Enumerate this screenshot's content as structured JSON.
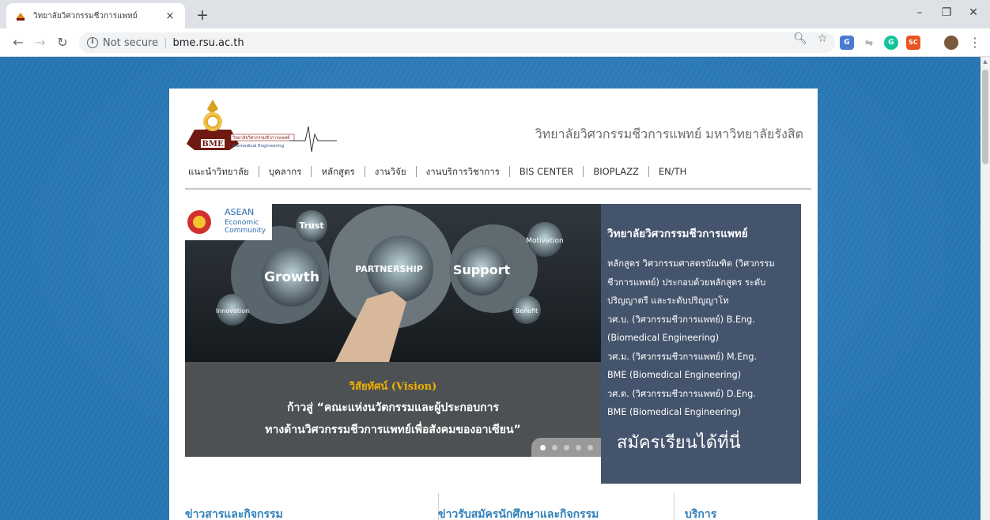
{
  "browser": {
    "tab_title": "วิทยาลัยวิศวกรรมชีวการแพทย์",
    "tab_close": "×",
    "new_tab": "+",
    "not_secure": "Not secure",
    "url": "bme.rsu.ac.th",
    "window_controls": {
      "minimize": "–",
      "restore": "❐",
      "close": "✕"
    },
    "extensions": [
      {
        "name": "translate",
        "label": "G",
        "color": "#4a7bd0"
      },
      {
        "name": "dropbox",
        "label": "⇋",
        "color": "#ffffff"
      },
      {
        "name": "grammarly",
        "label": "G",
        "color": "#15c39a"
      },
      {
        "name": "sc",
        "label": "SC",
        "color": "#e8551f"
      }
    ]
  },
  "site": {
    "logo_text": "BME",
    "logo_subtitle": "Biomedical Engineering",
    "logo_faculty": "วิทยาลัยวิศวกรรมชีวการแพทย์",
    "title": "วิทยาลัยวิศวกรรมชีวการแพทย์ มหาวิทยาลัยรังสิต",
    "nav": [
      "แนะนำวิทยาลัย",
      "บุคลากร",
      "หลักสูตร",
      "งานวิจัย",
      "งานบริการวิชาการ",
      "BIS CENTER",
      "BIOPLAZZ",
      "EN/TH"
    ]
  },
  "slider": {
    "badge": [
      "ASEAN",
      "Economic",
      "Community"
    ],
    "gears": [
      "Trust",
      "Growth",
      "PARTNERSHIP",
      "Support",
      "Motivation",
      "Innovation",
      "Benefit"
    ],
    "vision_label": "วิสัยทัศน์ (Vision)",
    "caption_line1": "ก้าวสู่ “คณะแห่งนวัตกรรมและผู้ประกอบการ",
    "caption_line2": "ทางด้านวิศวกรรมชีวการแพทย์เพื่อสังคมของอาเซียน”",
    "dots": 5,
    "active_dot": 0
  },
  "info_panel": {
    "heading": "วิทยาลัยวิศวกรรมชีวการแพทย์",
    "lines": [
      "หลักสูตร วิศวกรรมศาสตรบัณฑิต (วิศวกรรม",
      "ชีวการแพทย์) ประกอบด้วยหลักสูตร ระดับ",
      "ปริญญาตรี และระดับปริญญาโท",
      "วศ.บ. (วิศวกรรมชีวการแพทย์) B.Eng.",
      "(Biomedical Engineering)",
      "วศ.ม. (วิศวกรรมชีวการแพทย์) M.Eng.",
      "BME (Biomedical Engineering)",
      "วศ.ด. (วิศวกรรมชีวการแพทย์) D.Eng.",
      "BME (Biomedical Engineering)"
    ],
    "apply_link": "สมัครเรียนได้ที่นี่"
  },
  "sections": {
    "news": "ข่าวสารและกิจกรรม",
    "admissions": "ข่าวรับสมัครนักศึกษาและกิจกรรม",
    "services": "บริการ"
  },
  "colors": {
    "accent": "#2f7fb9",
    "panel": "#44546c",
    "vision": "#f0b000"
  }
}
